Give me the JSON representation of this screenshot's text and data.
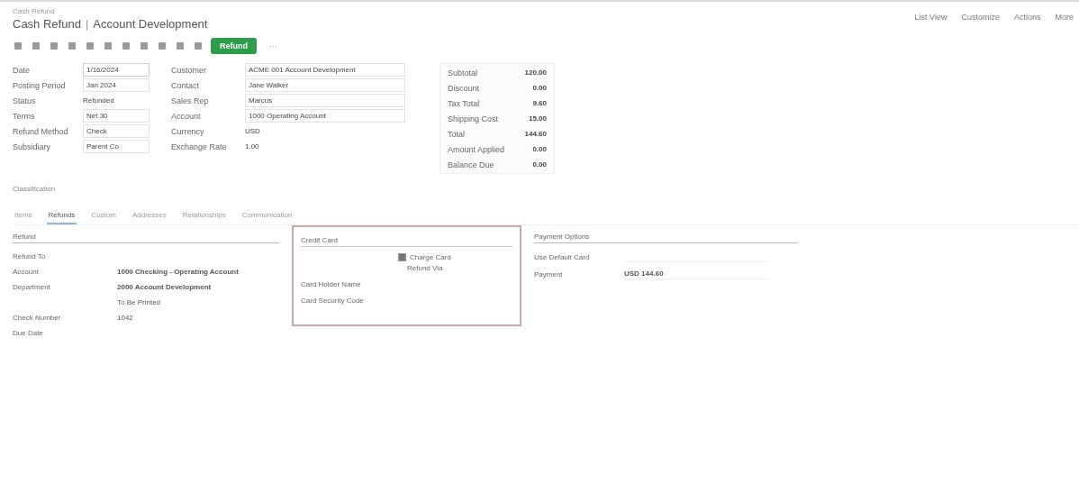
{
  "breadcrumb": "Cash Refund",
  "title": {
    "record": "Cash Refund",
    "separator": "|",
    "name": "Account Development"
  },
  "top_links": [
    "List View",
    "Customize",
    "Actions",
    "More"
  ],
  "toolbar": {
    "primary_button": "Refund",
    "more": "···"
  },
  "fields": [
    [
      {
        "label": "Date",
        "value": "1/16/2024",
        "kind": "input"
      },
      {
        "label": "Posting Period",
        "value": "Jan 2024",
        "kind": "select"
      },
      {
        "label": "Status",
        "value": "Refunded",
        "kind": "text"
      },
      {
        "label": "Terms",
        "value": "Net 30",
        "kind": "select"
      },
      {
        "label": "Refund Method",
        "value": "Check",
        "kind": "select"
      },
      {
        "label": "Subsidiary",
        "value": "Parent Co",
        "kind": "select"
      }
    ],
    [
      {
        "label": "Customer",
        "value": "ACME 001 Account Development",
        "kind": "select"
      },
      {
        "label": "Contact",
        "value": "Jane Walker",
        "kind": "select"
      },
      {
        "label": "Sales Rep",
        "value": "Marcus",
        "kind": "select"
      },
      {
        "label": "Account",
        "value": "1000 Operating Account",
        "kind": "select"
      },
      {
        "label": "Currency",
        "value": "USD",
        "kind": "text"
      },
      {
        "label": "Exchange Rate",
        "value": "1.00",
        "kind": "text"
      }
    ],
    [
      {
        "label": "Subtotal",
        "value": "120.00"
      },
      {
        "label": "Discount",
        "value": "0.00"
      },
      {
        "label": "Tax Total",
        "value": "9.60"
      },
      {
        "label": "Shipping Cost",
        "value": "15.00"
      },
      {
        "label": "Total",
        "value": "144.60"
      },
      {
        "label": "Amount Applied",
        "value": "0.00"
      },
      {
        "label": "Balance Due",
        "value": "0.00"
      }
    ]
  ],
  "classification": "Classification",
  "tabs": [
    {
      "label": "Items",
      "selected": false
    },
    {
      "label": "Refunds",
      "selected": true
    },
    {
      "label": "Custom",
      "selected": false
    },
    {
      "label": "Addresses",
      "selected": false
    },
    {
      "label": "Relationships",
      "selected": false
    },
    {
      "label": "Communication",
      "selected": false
    }
  ],
  "refund_section": {
    "title": "Refund",
    "rows": [
      {
        "label": "Refund To"
      },
      {
        "label": "Account",
        "value": "1000 Checking - Operating Account"
      },
      {
        "label": "Department",
        "value": "2000 Account Development"
      },
      {
        "label": "",
        "value": "To Be Printed"
      },
      {
        "label": "Check Number",
        "value": "1042"
      },
      {
        "label": "Due Date"
      }
    ]
  },
  "payment_section": {
    "title": "Credit Card",
    "checkbox": {
      "label": "Charge Card",
      "checked": true
    },
    "note": "Refund Via",
    "rows": [
      "Card Holder Name",
      "Card Security Code"
    ]
  },
  "options_section": {
    "title": "Payment Options",
    "rows": [
      {
        "label": "Use Default Card"
      },
      {
        "label": "Payment",
        "value": "USD 144.60"
      }
    ]
  }
}
